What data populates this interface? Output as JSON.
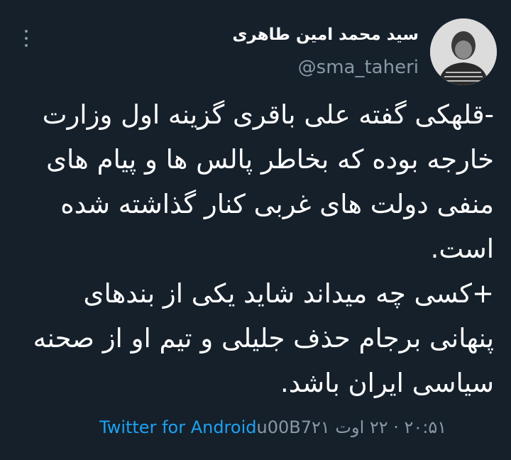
{
  "author": {
    "name": "سید محمد امین طاهری",
    "handle": "@sma_taheri"
  },
  "tweet": {
    "paragraphs": [
      "-قلهکی گفته علی باقری گزینه اول وزارت خارجه بوده که بخاطر پالس ها و پیام های منفی دولت های غربی کنار گذاشته شده است.",
      "+کسی چه میداند شاید یکی از بندهای پنهانی برجام حذف جلیلی و تیم او از صحنه سیاسی ایران باشد."
    ]
  },
  "meta": {
    "time": "۲۰:۵۱ · ۲۲ اوت ۲۱",
    "separator": " u00B7",
    "source": "Twitter for Android"
  },
  "colors": {
    "background": "#15202b",
    "text": "#ffffff",
    "secondary": "#8899a6",
    "link": "#1da1f2"
  },
  "icons": {
    "more": "more-vertical-icon"
  }
}
